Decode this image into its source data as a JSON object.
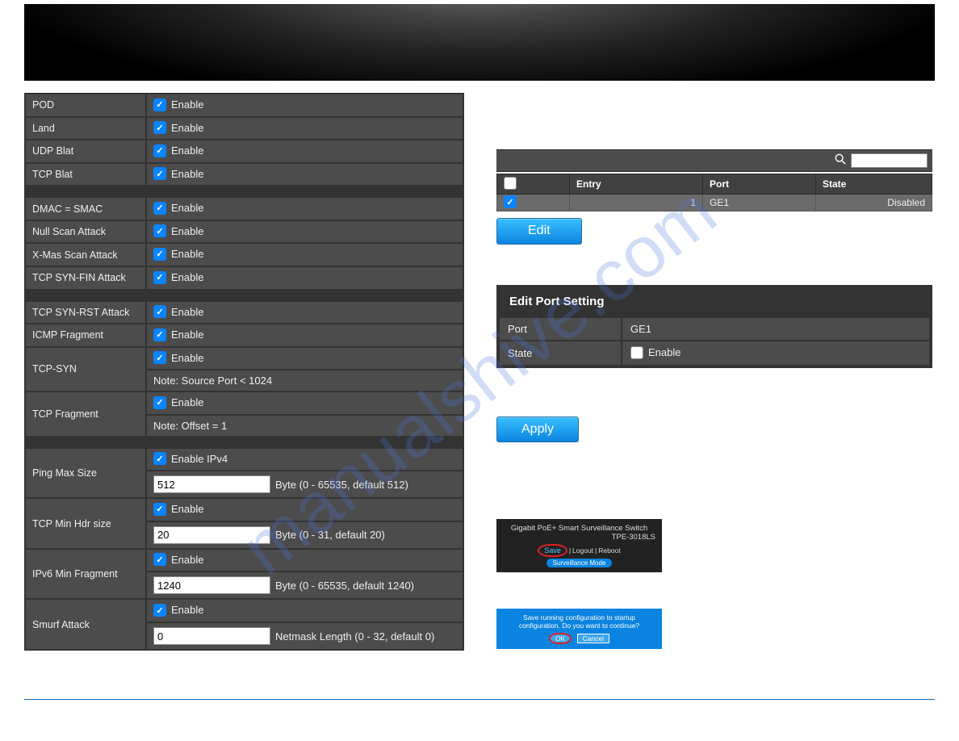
{
  "watermark": "manualshive.com",
  "left": {
    "rows1": [
      {
        "label": "POD",
        "enable": "Enable"
      },
      {
        "label": "Land",
        "enable": "Enable"
      },
      {
        "label": "UDP Blat",
        "enable": "Enable"
      },
      {
        "label": "TCP Blat",
        "enable": "Enable"
      }
    ],
    "rows2": [
      {
        "label": "DMAC = SMAC",
        "enable": "Enable"
      },
      {
        "label": "Null Scan Attack",
        "enable": "Enable"
      },
      {
        "label": "X-Mas Scan Attack",
        "enable": "Enable"
      },
      {
        "label": "TCP SYN-FIN Attack",
        "enable": "Enable"
      }
    ],
    "rows3": [
      {
        "label": "TCP SYN-RST Attack",
        "enable": "Enable"
      },
      {
        "label": "ICMP Fragment",
        "enable": "Enable"
      }
    ],
    "tcp_syn": {
      "label": "TCP-SYN",
      "enable": "Enable",
      "note": "Note: Source Port < 1024"
    },
    "tcp_fragment": {
      "label": "TCP Fragment",
      "enable": "Enable",
      "note": "Note: Offset = 1"
    },
    "ping_max": {
      "label": "Ping Max Size",
      "enable": "Enable IPv4",
      "value": "512",
      "hint": "Byte (0 - 65535, default 512)"
    },
    "tcp_min_hdr": {
      "label": "TCP Min Hdr size",
      "enable": "Enable",
      "value": "20",
      "hint": "Byte (0 - 31, default 20)"
    },
    "ipv6_min_frag": {
      "label": "IPv6 Min Fragment",
      "enable": "Enable",
      "value": "1240",
      "hint": "Byte (0 - 65535, default 1240)"
    },
    "smurf": {
      "label": "Smurf Attack",
      "enable": "Enable",
      "value": "0",
      "hint": "Netmask Length (0 - 32, default 0)"
    }
  },
  "port_table": {
    "headers": {
      "entry": "Entry",
      "port": "Port",
      "state": "State"
    },
    "row": {
      "entry": "1",
      "port": "GE1",
      "state": "Disabled"
    }
  },
  "buttons": {
    "edit": "Edit",
    "apply": "Apply"
  },
  "edit_port": {
    "title": "Edit Port Setting",
    "port_label": "Port",
    "port_value": "GE1",
    "state_label": "State",
    "state_enable": "Enable"
  },
  "thumb": {
    "line1": "Gigabit PoE+ Smart Surveillance Switch",
    "line2": "TPE-3018LS",
    "save": "Save",
    "logout": "Logout",
    "reboot": "Reboot",
    "mode": "Surveillance Mode"
  },
  "prompt": {
    "text": "Save running configuration to startup configuration. Do you want to continue?",
    "ok": "OK",
    "cancel": "Cancel"
  }
}
